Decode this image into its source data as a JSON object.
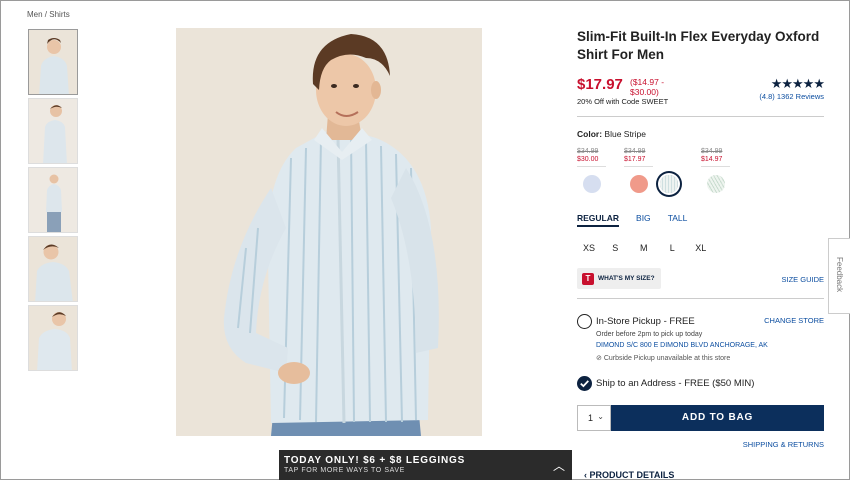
{
  "breadcrumb": {
    "parent": "Men",
    "sep": "/",
    "current": "Shirts"
  },
  "product": {
    "title": "Slim-Fit Built-In Flex Everyday Oxford Shirt For Men",
    "price": "$17.97",
    "price_range_line1": "($14.97 -",
    "price_range_line2": "$30.00)",
    "promo": "20% Off with Code SWEET",
    "stars": "★★★★★",
    "rating_text": "(4.8) 1362 Reviews"
  },
  "color": {
    "label": "Color:",
    "selected": "Blue Stripe",
    "groups": [
      {
        "old": "$34.99",
        "new": "$30.00"
      },
      {
        "old": "$34.99",
        "new": "$17.97"
      },
      {
        "old": "$34.99",
        "new": "$14.97"
      }
    ],
    "swatch_colors": [
      "#d6def0",
      "#f09a8a",
      "#eef3f1",
      "#dde7e1"
    ]
  },
  "fits": [
    "REGULAR",
    "BIG",
    "TALL"
  ],
  "sizes": [
    "XS",
    "S",
    "M",
    "L",
    "XL"
  ],
  "size_help": {
    "logo": "T",
    "label": "WHAT'S MY SIZE?",
    "guide": "SIZE GUIDE"
  },
  "pickup": {
    "title": "In-Store Pickup - FREE",
    "change": "CHANGE STORE",
    "note": "Order before 2pm to pick up today",
    "store": "DIMOND S/C 800 E DIMOND BLVD  ANCHORAGE, AK",
    "curbside": "Curbside Pickup unavailable at this store"
  },
  "ship": {
    "title": "Ship to an Address - FREE ($50 MIN)"
  },
  "bag": {
    "qty": "1",
    "button": "ADD TO BAG",
    "shipping_returns": "SHIPPING & RETURNS"
  },
  "details": {
    "label": "PRODUCT DETAILS",
    "chevron": "‹"
  },
  "feedback": "Feedback",
  "promo_bar": {
    "line1": "TODAY ONLY! $6 + $8 LEGGINGS",
    "line2": "TAP FOR MORE WAYS TO SAVE"
  },
  "colors": {
    "brand_navy": "#0c2240",
    "sale_red": "#c8102e",
    "link_blue": "#0c4ea0"
  }
}
